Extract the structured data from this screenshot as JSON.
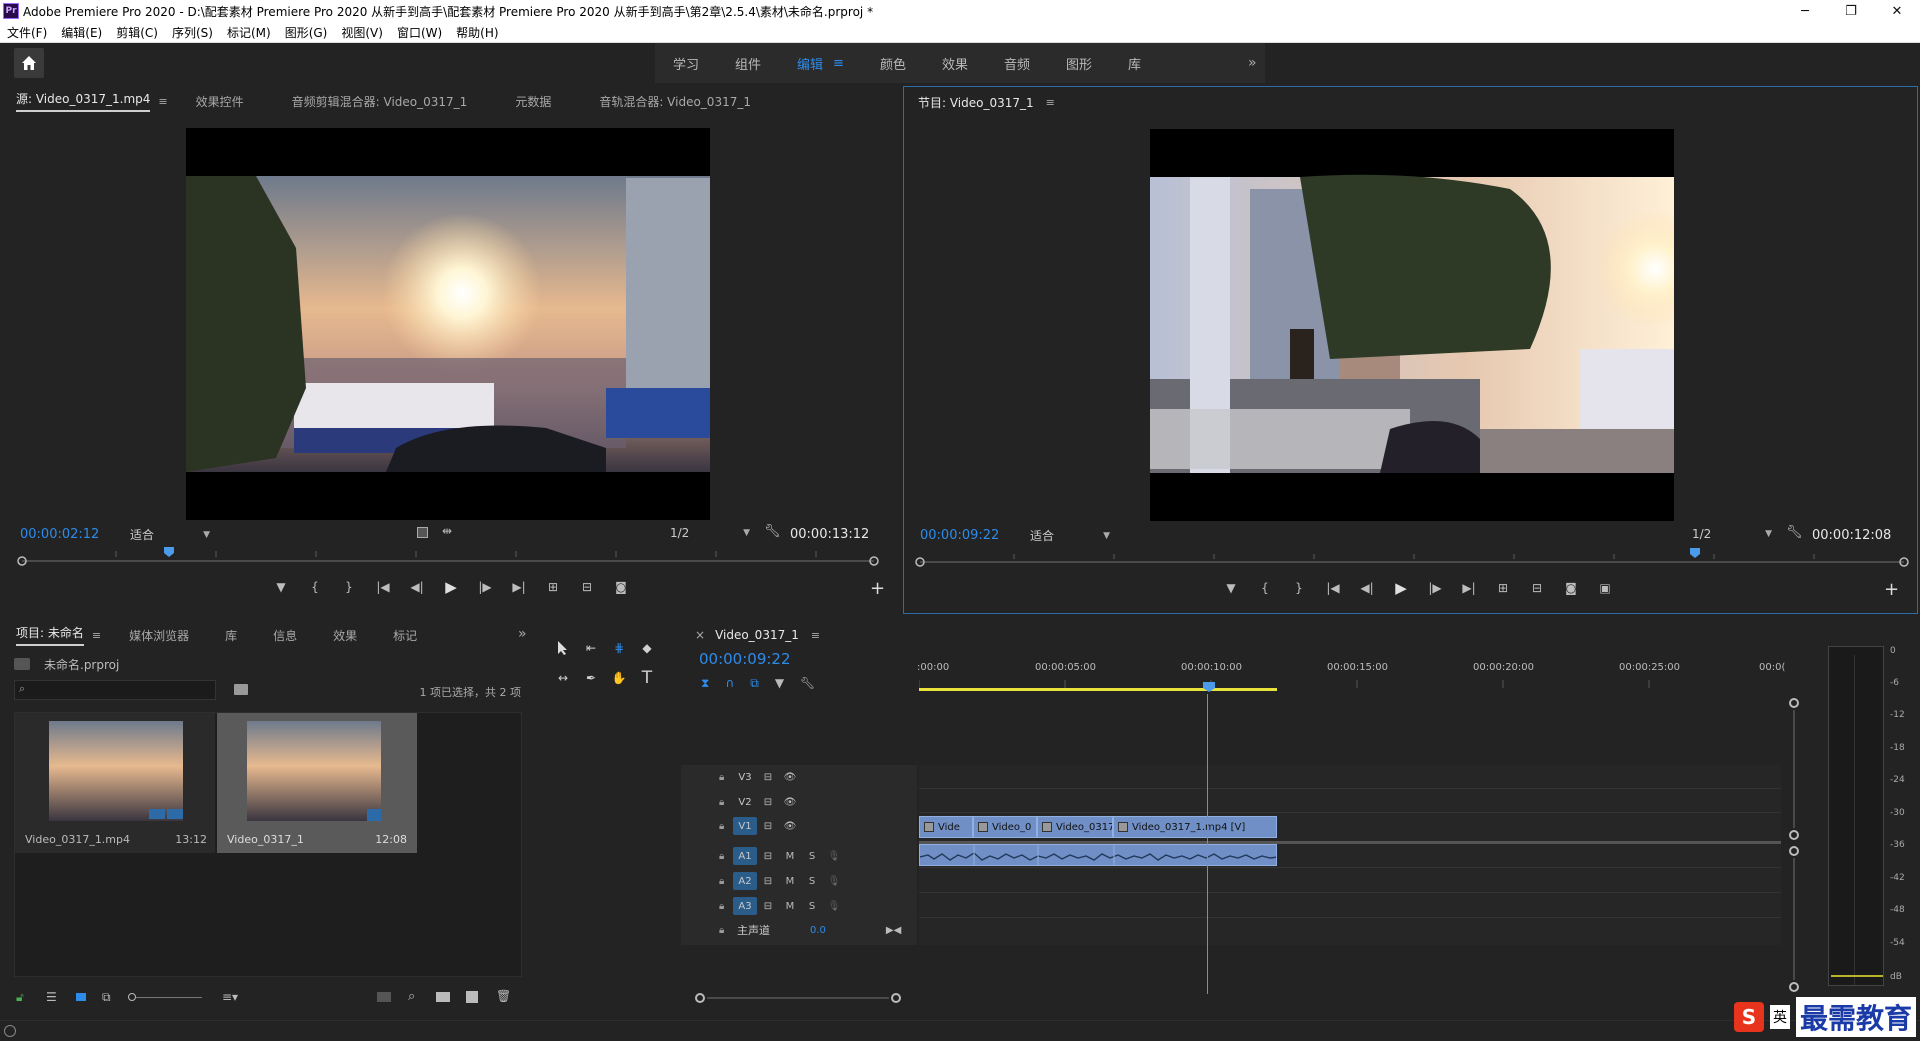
{
  "window": {
    "app_icon": "Pr",
    "title": "Adobe Premiere Pro 2020 - D:\\配套素材 Premiere Pro 2020 从新手到高手\\配套素材 Premiere Pro 2020 从新手到高手\\第2章\\2.5.4\\素材\\未命名.prproj *",
    "minimize": "─",
    "maximize": "❐",
    "close": "✕"
  },
  "menu": [
    "文件(F)",
    "编辑(E)",
    "剪辑(C)",
    "序列(S)",
    "标记(M)",
    "图形(G)",
    "视图(V)",
    "窗口(W)",
    "帮助(H)"
  ],
  "workspaces": {
    "tabs": [
      "学习",
      "组件",
      "编辑",
      "颜色",
      "效果",
      "音频",
      "图形",
      "库"
    ],
    "active": "编辑",
    "active_menu": "≡",
    "more": "»"
  },
  "source_panel": {
    "tabs": [
      "源: Video_0317_1.mp4",
      "效果控件",
      "音频剪辑混合器: Video_0317_1",
      "元数据",
      "音轨混合器: Video_0317_1"
    ],
    "active_tab_menu": "≡",
    "timecode": "00:00:02:12",
    "zoom": "适合",
    "resolution": "1/2",
    "duration": "00:00:13:12"
  },
  "program_panel": {
    "title": "节目: Video_0317_1",
    "menu": "≡",
    "timecode": "00:00:09:22",
    "zoom": "适合",
    "resolution": "1/2",
    "duration": "00:00:12:08"
  },
  "project_panel": {
    "tabs": [
      "项目: 未命名",
      "媒体浏览器",
      "库",
      "信息",
      "效果",
      "标记"
    ],
    "active_tab_menu": "≡",
    "more": "»",
    "project_file": "未命名.prproj",
    "selection_info": "1 项已选择，共 2 项",
    "items": [
      {
        "name": "Video_0317_1.mp4",
        "duration": "13:12"
      },
      {
        "name": "Video_0317_1",
        "duration": "12:08"
      }
    ]
  },
  "timeline": {
    "sequence_name": "Video_0317_1",
    "close": "×",
    "menu": "≡",
    "timecode": "00:00:09:22",
    "ruler": [
      ":00:00",
      "00:00:05:00",
      "00:00:10:00",
      "00:00:15:00",
      "00:00:20:00",
      "00:00:25:00",
      "00:0("
    ],
    "video_tracks": [
      "V3",
      "V2",
      "V1"
    ],
    "audio_tracks": [
      "A1",
      "A2",
      "A3"
    ],
    "mute": "M",
    "solo": "S",
    "master_label": "主声道",
    "master_value": "0.0",
    "clips": [
      "Vide",
      "Video_0",
      "Video_0317",
      "Video_0317_1.mp4 [V]"
    ]
  },
  "audio_meter": {
    "labels": [
      "0",
      "-6",
      "-12",
      "-18",
      "-24",
      "-30",
      "-36",
      "-42",
      "-48",
      "-54",
      "dB"
    ]
  },
  "watermark": {
    "ime": "英",
    "text": "最需教育"
  },
  "colors": {
    "accent_blue": "#2d8ceb",
    "clip_blue": "#6f8fc6",
    "playhead": "#4b9bea",
    "work_area": "#e8e23a"
  }
}
